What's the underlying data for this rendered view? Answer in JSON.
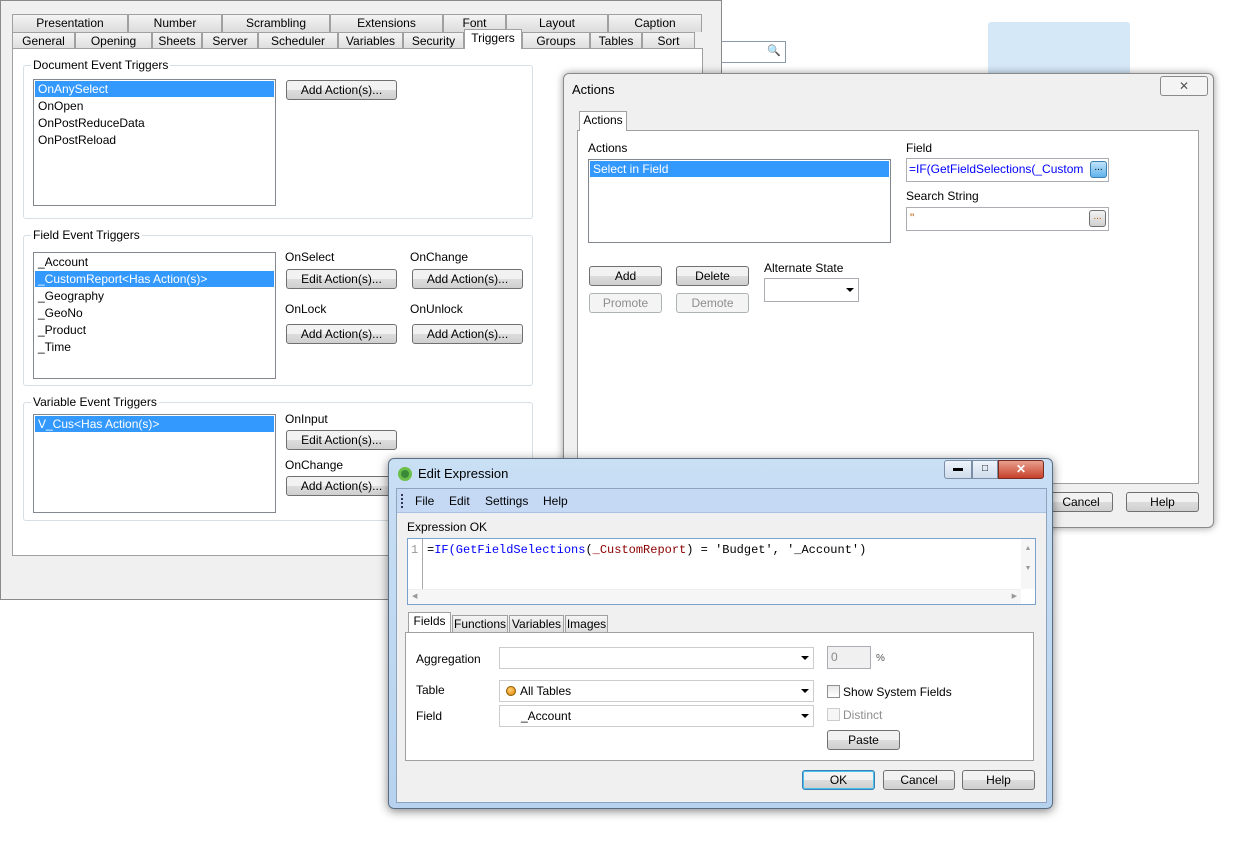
{
  "properties": {
    "tabs_row1": [
      "Presentation",
      "Number",
      "Scrambling",
      "Extensions",
      "Font",
      "Layout",
      "Caption"
    ],
    "tabs_row2": [
      "General",
      "Opening",
      "Sheets",
      "Server",
      "Scheduler",
      "Variables",
      "Security",
      "Triggers",
      "Groups",
      "Tables",
      "Sort"
    ],
    "active_tab": "Triggers",
    "document_triggers": {
      "title": "Document Event Triggers",
      "items": [
        "OnAnySelect",
        "OnOpen",
        "OnPostReduceData",
        "OnPostReload"
      ],
      "selected": "OnAnySelect",
      "button": "Add Action(s)..."
    },
    "field_triggers": {
      "title": "Field Event Triggers",
      "items": [
        "_Account",
        "_CustomReport<Has Action(s)>",
        "_Geography",
        "_GeoNo",
        "_Product",
        "_Time"
      ],
      "selected": "_CustomReport<Has Action(s)>",
      "on_select": {
        "label": "OnSelect",
        "button": "Edit Action(s)..."
      },
      "on_change": {
        "label": "OnChange",
        "button": "Add Action(s)..."
      },
      "on_lock": {
        "label": "OnLock",
        "button": "Add Action(s)..."
      },
      "on_unlock": {
        "label": "OnUnlock",
        "button": "Add Action(s)..."
      }
    },
    "variable_triggers": {
      "title": "Variable Event Triggers",
      "items": [
        "V_Cus<Has Action(s)>"
      ],
      "selected": "V_Cus<Has Action(s)>",
      "on_input": {
        "label": "OnInput",
        "button": "Edit Action(s)..."
      },
      "on_change": {
        "label": "OnChange",
        "button": "Add Action(s)..."
      }
    }
  },
  "actions_dialog": {
    "title": "Actions",
    "tab": "Actions",
    "actions_label": "Actions",
    "actions": [
      "Select in Field"
    ],
    "field_label": "Field",
    "field_value": "=IF(GetFieldSelections(_Custom",
    "search_label": "Search String",
    "search_value": "\"",
    "add": "Add",
    "delete": "Delete",
    "promote": "Promote",
    "demote": "Demote",
    "alternate_state_label": "Alternate State",
    "cancel": "Cancel",
    "help": "Help",
    "dots": "..."
  },
  "edit_expression": {
    "title": "Edit Expression",
    "menu": [
      "File",
      "Edit",
      "Settings",
      "Help"
    ],
    "status": "Expression OK",
    "line_number": "1",
    "expr": {
      "p1": "=",
      "p2": "IF(GetFieldSelections",
      "p3": "(",
      "p4": "_CustomReport",
      "p5": ") = 'Budget', '_Account')"
    },
    "tabs": [
      "Fields",
      "Functions",
      "Variables",
      "Images"
    ],
    "aggregation_label": "Aggregation",
    "percent_value": "0",
    "percent_sign": "%",
    "table_label": "Table",
    "table_value": "All Tables",
    "field_label": "Field",
    "field_value": "_Account",
    "show_system_fields": "Show System Fields",
    "distinct": "Distinct",
    "paste": "Paste",
    "ok": "OK",
    "cancel": "Cancel",
    "help": "Help",
    "colors": {
      "keyword": "#0000ff",
      "field": "#8b0000",
      "menubar": "#c5d9f5"
    }
  }
}
